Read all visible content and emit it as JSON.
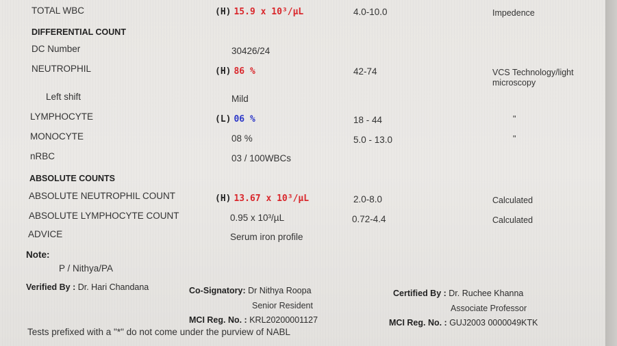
{
  "rows": [
    {
      "label": "TOTAL WBC",
      "flag": "(H)",
      "value": "15.9 x 10³/µL",
      "range": "4.0-10.0",
      "method": "Impedence"
    },
    {
      "section": "DIFFERENTIAL COUNT"
    },
    {
      "label": "DC Number",
      "value": "30426/24"
    },
    {
      "label": "NEUTROPHIL",
      "flag": "(H)",
      "value": "86 %",
      "range": "42-74",
      "method_line1": "VCS Technology/light",
      "method_line2": "microscopy"
    },
    {
      "label": "Left shift",
      "value": "Mild"
    },
    {
      "label": "LYMPHOCYTE",
      "flag": "(L)",
      "value": "06 %",
      "range": "18 - 44",
      "method": "\""
    },
    {
      "label": "MONOCYTE",
      "value": "08 %",
      "range": "5.0 - 13.0",
      "method": "\""
    },
    {
      "label": "nRBC",
      "value": "03 / 100WBCs"
    },
    {
      "section": "ABSOLUTE COUNTS"
    },
    {
      "label": "ABSOLUTE NEUTROPHIL COUNT",
      "flag": "(H)",
      "value": "13.67 x 10³/µL",
      "range": "2.0-8.0",
      "method": "Calculated"
    },
    {
      "label": "ABSOLUTE LYMPHOCYTE COUNT",
      "value": "0.95 x 10³/µL",
      "range": "0.72-4.4",
      "method": "Calculated"
    },
    {
      "label": "ADVICE",
      "value": "Serum iron profile"
    }
  ],
  "note": {
    "label": "Note:",
    "text": "P / Nithya/PA"
  },
  "signatures": {
    "verified_label": "Verified By :",
    "verified_name": "Dr. Hari Chandana",
    "cosign_label": "Co-Signatory:",
    "cosign_name": "Dr Nithya Roopa",
    "cosign_role": "Senior Resident",
    "mci1_label": "MCI Reg. No. :",
    "mci1_value": "KRL20200001127",
    "certified_label": "Certified By :",
    "certified_name": "Dr. Ruchee Khanna",
    "certified_role": "Associate Professor",
    "mci2_label": "MCI Reg. No. :",
    "mci2_value": "GUJ2003 0000049KTK"
  },
  "footer": "Tests prefixed with a \"*\" do not come under the purview of NABL"
}
